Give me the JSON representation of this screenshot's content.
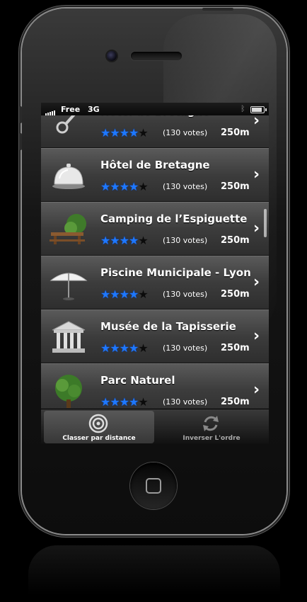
{
  "status_bar": {
    "carrier": "Free",
    "network": "3G"
  },
  "places": [
    {
      "title": "Hôtel de Bretagne",
      "rating": 4,
      "max_rating": 5,
      "votes": "(130 votes)",
      "distance": "250m",
      "icon": "bellhop-key-icon"
    },
    {
      "title": "Hôtel de Bretagne",
      "rating": 4,
      "max_rating": 5,
      "votes": "(130 votes)",
      "distance": "250m",
      "icon": "room-service-bell-icon"
    },
    {
      "title": "Camping de l’Espiguette",
      "rating": 4,
      "max_rating": 5,
      "votes": "(130 votes)",
      "distance": "250m",
      "icon": "picnic-table-tree-icon"
    },
    {
      "title": "Piscine Municipale - Lyon",
      "rating": 4,
      "max_rating": 5,
      "votes": "(130 votes)",
      "distance": "250m",
      "icon": "parasol-icon"
    },
    {
      "title": "Musée de la Tapisserie",
      "rating": 4,
      "max_rating": 5,
      "votes": "(130 votes)",
      "distance": "250m",
      "icon": "museum-building-icon"
    },
    {
      "title": "Parc Naturel",
      "rating": 4,
      "max_rating": 5,
      "votes": "(130 votes)",
      "distance": "250m",
      "icon": "tree-icon"
    }
  ],
  "tabbar": {
    "sort_distance": {
      "label": "Classer par distance",
      "icon": "target-icon"
    },
    "reverse_order": {
      "label": "Inverser L'ordre",
      "icon": "refresh-icon"
    }
  },
  "colors": {
    "star_active": "#1e78ff",
    "star_inactive": "#0b0b0b"
  }
}
